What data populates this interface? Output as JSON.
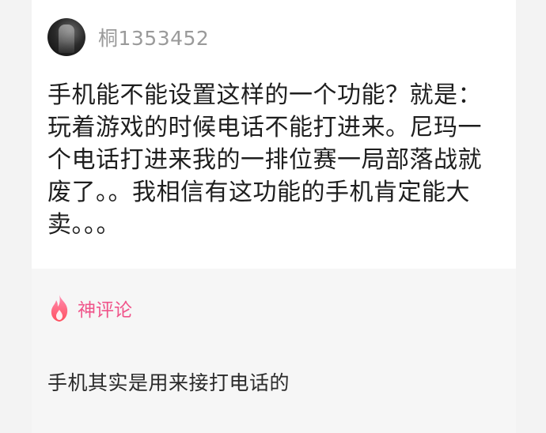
{
  "post": {
    "username": "桐1353452",
    "text": "手机能不能设置这样的一个功能？就是：玩着游戏的时候电话不能打进来。尼玛一个电话打进来我的一排位赛一局部落战就废了。。我相信有这功能的手机肯定能大卖。。。"
  },
  "hot_comment": {
    "label": "神评论",
    "icon": "flame-icon",
    "text": "手机其实是用来接打电话的"
  },
  "colors": {
    "accent": "#f0548a",
    "username": "#9a9a9a"
  }
}
